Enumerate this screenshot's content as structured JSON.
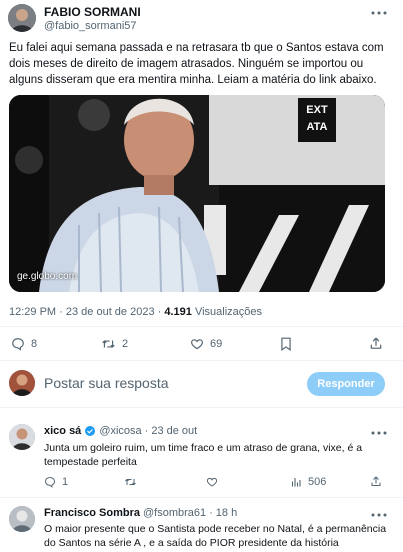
{
  "tweet": {
    "author_name": "FABIO SORMANI",
    "author_handle": "@fabio_sormani57",
    "text": "Eu falei aqui semana passada e na retrasara tb que o Santos estava com dois meses de direito de imagem atrasados. Ninguém se importou ou alguns disseram que era mentira minha. Leiam a matéria do link abaixo.",
    "image_source": "ge.globo.com",
    "image_sign_line1": "EXT",
    "image_sign_line2": "ATA",
    "time": "12:29 PM",
    "date_sep": " · ",
    "date": "23 de out de 2023",
    "views_sep": " · ",
    "views_count": "4.191",
    "views_label": " Visualizações",
    "stats": {
      "replies": "8",
      "retweets": "2",
      "likes": "69"
    }
  },
  "compose": {
    "placeholder": "Postar sua resposta",
    "button": "Responder"
  },
  "replies": [
    {
      "name": "xico sá",
      "handle": "@xicosa",
      "dot": "·",
      "date": "23 de out",
      "text": "Junta um goleiro ruim, um time fraco e um atraso de grana, vixe, é a tempestade perfeita",
      "stats": {
        "replies": "1",
        "views": "506"
      }
    },
    {
      "name": "Francisco Sombra",
      "handle": "@fsombra61",
      "dot": "·",
      "date": "18 h",
      "text": "O maior presente que o Santista pode receber no Natal, é a permanência do Santos na série A , e a saída do PIOR presidente da história"
    }
  ],
  "icons": [
    "more-icon",
    "reply-icon",
    "retweet-icon",
    "like-icon",
    "bookmark-icon",
    "share-icon",
    "verified-icon",
    "views-icon"
  ],
  "colors": {
    "accent": "#1d9bf0",
    "button_disabled": "#8ecdf8",
    "text": "#0f1419",
    "muted": "#536471"
  }
}
